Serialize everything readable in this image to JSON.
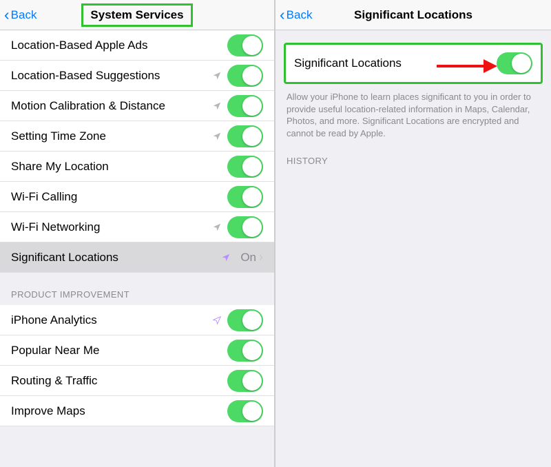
{
  "left": {
    "back_label": "Back",
    "title": "System Services",
    "rows": [
      {
        "label": "Location-Based Apple Ads",
        "arrow": "none",
        "kind": "toggle"
      },
      {
        "label": "Location-Based Suggestions",
        "arrow": "gray",
        "kind": "toggle"
      },
      {
        "label": "Motion Calibration & Distance",
        "arrow": "gray",
        "kind": "toggle"
      },
      {
        "label": "Setting Time Zone",
        "arrow": "gray",
        "kind": "toggle"
      },
      {
        "label": "Share My Location",
        "arrow": "none",
        "kind": "toggle"
      },
      {
        "label": "Wi-Fi Calling",
        "arrow": "none",
        "kind": "toggle"
      },
      {
        "label": "Wi-Fi Networking",
        "arrow": "gray",
        "kind": "toggle"
      }
    ],
    "siglocrow": {
      "label": "Significant Locations",
      "status": "On"
    },
    "section_header": "PRODUCT IMPROVEMENT",
    "rows2": [
      {
        "label": "iPhone Analytics",
        "arrow": "purple-out",
        "kind": "toggle"
      },
      {
        "label": "Popular Near Me",
        "arrow": "none",
        "kind": "toggle"
      },
      {
        "label": "Routing & Traffic",
        "arrow": "none",
        "kind": "toggle"
      },
      {
        "label": "Improve Maps",
        "arrow": "none",
        "kind": "toggle"
      }
    ]
  },
  "right": {
    "back_label": "Back",
    "title": "Significant Locations",
    "toggle_label": "Significant Locations",
    "description": "Allow your iPhone to learn places significant to you in order to provide useful location-related information in Maps, Calendar, Photos, and more. Significant Locations are encrypted and cannot be read by Apple.",
    "history_header": "HISTORY"
  }
}
